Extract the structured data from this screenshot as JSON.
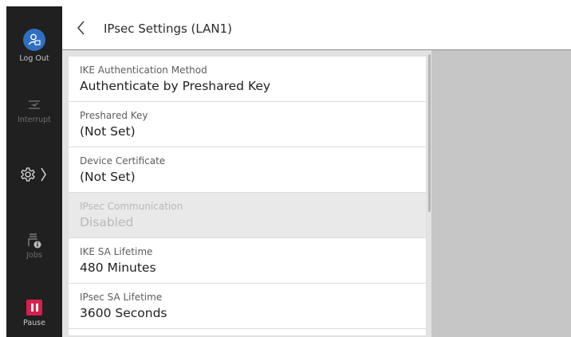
{
  "sidebar": {
    "logout_label": "Log Out",
    "interrupt_label": "Interrupt",
    "jobs_label": "Jobs",
    "pause_label": "Pause",
    "accent_color": "#2f6fc1",
    "pause_color": "#d81f4b"
  },
  "header": {
    "title": "IPsec Settings (LAN1)"
  },
  "settings": [
    {
      "label": "IKE Authentication Method",
      "value": "Authenticate by Preshared Key",
      "disabled": false
    },
    {
      "label": "Preshared Key",
      "value": "(Not Set)",
      "disabled": false
    },
    {
      "label": "Device Certificate",
      "value": "(Not Set)",
      "disabled": false
    },
    {
      "label": "IPsec Communication",
      "value": "Disabled",
      "disabled": true
    },
    {
      "label": "IKE SA Lifetime",
      "value": "480 Minutes",
      "disabled": false
    },
    {
      "label": "IPsec SA Lifetime",
      "value": "3600 Seconds",
      "disabled": false
    }
  ]
}
